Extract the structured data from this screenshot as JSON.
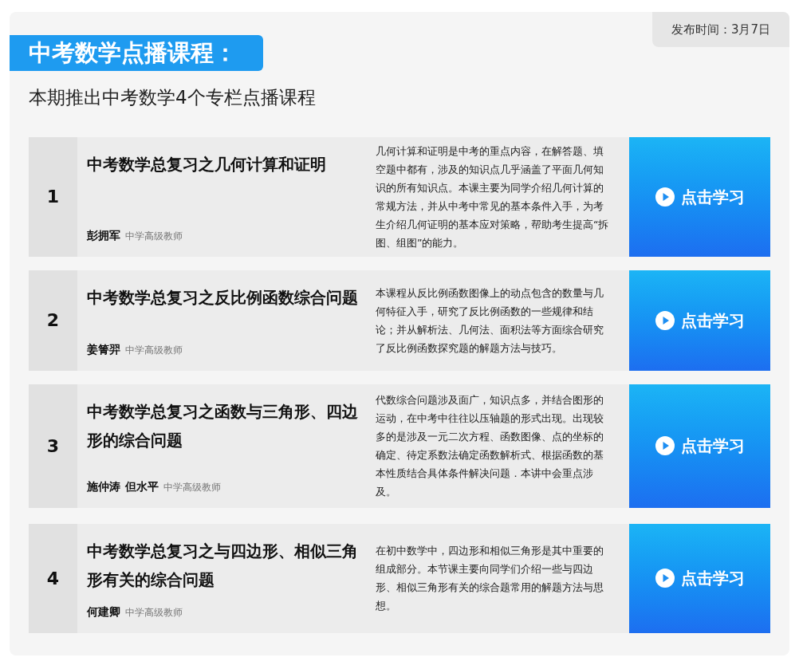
{
  "publish_time": "发布时间：3月7日",
  "heading": "中考数学点播课程：",
  "subtitle": "本期推出中考数学4个专栏点播课程",
  "courses": [
    {
      "number": "1",
      "title": "中考数学总复习之几何计算和证明",
      "teachers": [
        "彭拥军"
      ],
      "rank": "中学高级教师",
      "description": "几何计算和证明是中考的重点内容，在解答题、填空题中都有，涉及的知识点几乎涵盖了平面几何知识的所有知识点。本课主要为同学介绍几何计算的常规方法，并从中考中常见的基本条件入手，为考生介绍几何证明的基本应对策略，帮助考生提高“拆图、组图”的能力。",
      "button": "点击学习"
    },
    {
      "number": "2",
      "title": "中考数学总复习之反比例函数综合问题",
      "teachers": [
        "姜箐羿"
      ],
      "rank": "中学高级教师",
      "description": "本课程从反比例函数图像上的动点包含的数量与几何特征入手，研究了反比例函数的一些规律和结论；并从解析法、几何法、面积法等方面综合研究了反比例函数探究题的解题方法与技巧。",
      "button": "点击学习"
    },
    {
      "number": "3",
      "title": "中考数学总复习之函数与三角形、四边形的综合问题",
      "teachers": [
        "施仲涛",
        "但水平"
      ],
      "rank": "中学高级教师",
      "description": "代数综合问题涉及面广，知识点多，并结合图形的运动，在中考中往往以压轴题的形式出现。出现较多的是涉及一元二次方程、函数图像、点的坐标的确定、待定系数法确定函数解析式、根据函数的基本性质结合具体条件解决问题．本讲中会重点涉及。",
      "button": "点击学习"
    },
    {
      "number": "4",
      "title": "中考数学总复习之与四边形、相似三角形有关的综合问题",
      "teachers": [
        "何建卿"
      ],
      "rank": "中学高级教师",
      "description": "在初中数学中，四边形和相似三角形是其中重要的组成部分。本节课主要向同学们介绍一些与四边形、相似三角形有关的综合题常用的解题方法与思想。",
      "button": "点击学习"
    }
  ]
}
